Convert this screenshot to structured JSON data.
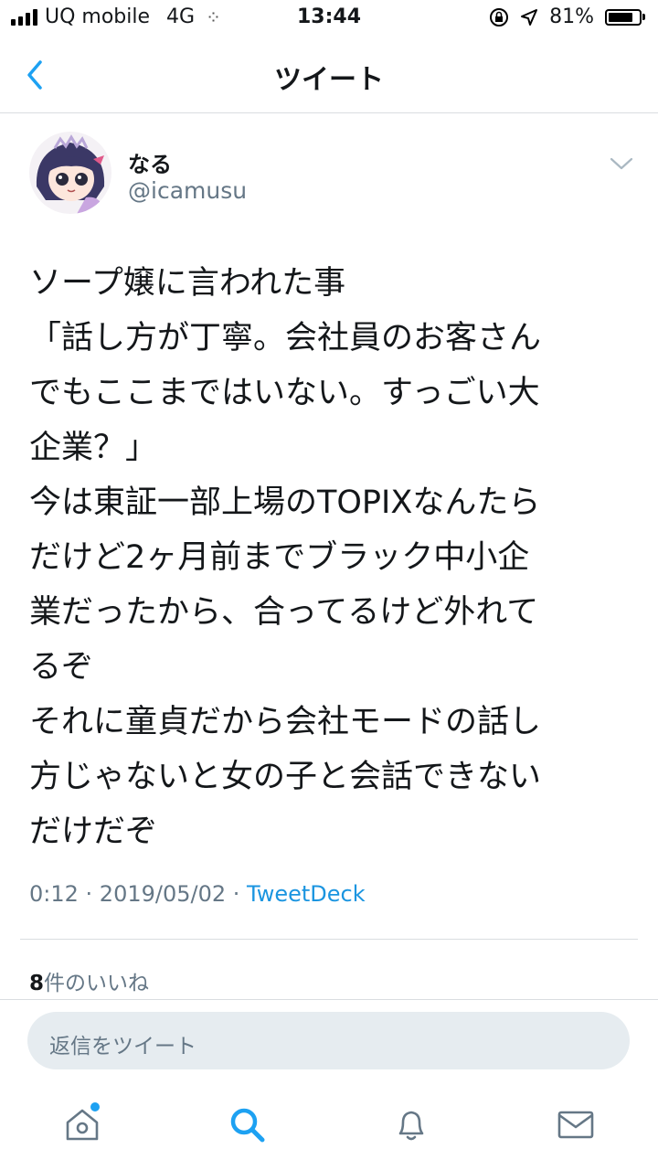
{
  "status_bar": {
    "carrier": "UQ mobile",
    "network": "4G",
    "time": "13:44",
    "battery": "81%",
    "battery_level": 0.81
  },
  "nav": {
    "title": "ツイート",
    "back_icon": "chevron-left-icon"
  },
  "tweet": {
    "user_name": "なる",
    "user_handle": "@icamusu",
    "text": "ソープ嬢に言われた事\n「話し方が丁寧。会社員のお客さん\nでもここまではいない。すっごい大\n企業？」\n今は東証一部上場のTOPIXなんたら\nだけど2ヶ月前までブラック中小企\n業だったから、合ってるけど外れて\nるぞ\nそれに童貞だから会社モードの話し\n方じゃないと女の子と会話できない\nだけだぞ",
    "time": "0:12",
    "date": "2019/05/02",
    "source": "TweetDeck",
    "sep": " · ",
    "likes_count": "8",
    "likes_label": "件のいいね"
  },
  "reply": {
    "placeholder": "返信をツイート"
  },
  "tabs": [
    {
      "name": "home",
      "icon": "home-icon"
    },
    {
      "name": "search",
      "icon": "search-icon",
      "active": true
    },
    {
      "name": "notifications",
      "icon": "bell-icon"
    },
    {
      "name": "messages",
      "icon": "mail-icon"
    }
  ],
  "colors": {
    "accent": "#1da1f2",
    "link": "#1b95e0",
    "muted": "#657786",
    "reply_bg": "#e6ecf0"
  }
}
